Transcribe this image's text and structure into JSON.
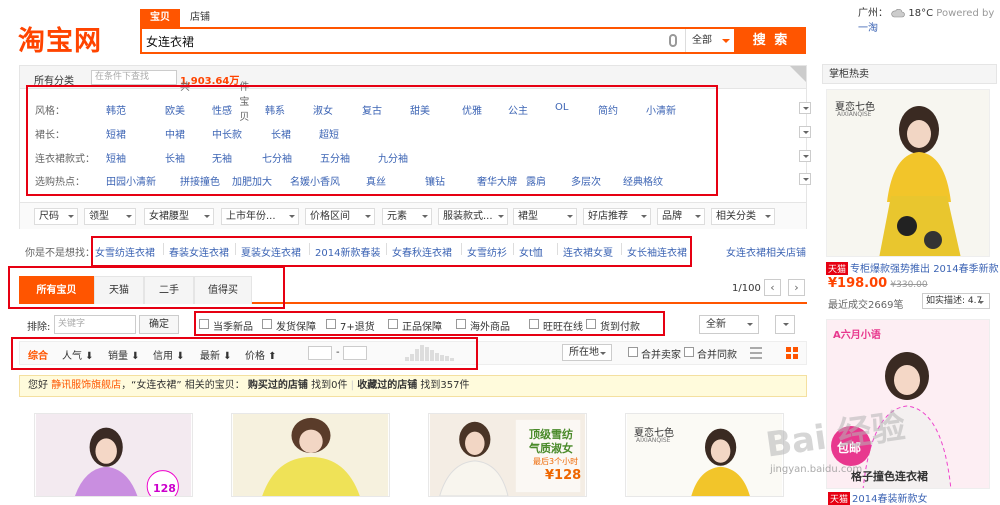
{
  "header": {
    "logo": "淘宝网",
    "search_tabs": [
      "宝贝",
      "店铺"
    ],
    "search_value": "女连衣裙",
    "search_scope": "全部",
    "search_button": "搜 索",
    "city": "广州：",
    "temperature": "18°C",
    "powered_by": "Powered by",
    "powered_brand": "一淘"
  },
  "filter": {
    "all_category": "所有分类",
    "search_placeholder": "在条件下查找",
    "count_prefix": "共",
    "count": "1,903.64万",
    "count_suffix": "件宝贝",
    "rows": [
      {
        "label": "风格：",
        "items": [
          "韩范",
          "欧美",
          "性感",
          "韩系",
          "淑女",
          "复古",
          "甜美",
          "优雅",
          "公主",
          "OL",
          "简约",
          "小清新"
        ]
      },
      {
        "label": "裙长：",
        "items": [
          "短裙",
          "中裙",
          "中长款",
          "长裙",
          "超短"
        ]
      },
      {
        "label": "连衣裙款式：",
        "items": [
          "短袖",
          "长袖",
          "无袖",
          "七分袖",
          "五分袖",
          "九分袖"
        ]
      },
      {
        "label": "选购热点：",
        "items": [
          "田园小清新",
          "拼接撞色",
          "加肥加大",
          "名媛小香风",
          "真丝",
          "镶钻",
          "奢华大牌",
          "露肩",
          "多层次",
          "经典格纹"
        ]
      }
    ],
    "dropdowns": [
      "尺码",
      "领型",
      "女裙腰型",
      "上市年份...",
      "价格区间",
      "元素",
      "服装款式...",
      "裙型",
      "好店推荐",
      "品牌",
      "相关分类"
    ]
  },
  "want": {
    "label": "你是不是想找：",
    "items": [
      "女雪纺连衣裙",
      "春装女连衣裙",
      "夏装女连衣裙",
      "2014新款春装",
      "女春秋连衣裙",
      "女雪纺衫",
      "女t恤",
      "连衣裙女夏",
      "女长袖连衣裙"
    ],
    "related": "女连衣裙相关店铺"
  },
  "tabs": [
    "所有宝贝",
    "天猫",
    "二手",
    "值得买"
  ],
  "pager": {
    "text": "1/100",
    "prev": "‹",
    "next": "›"
  },
  "options": {
    "exclude_label": "排除:",
    "exclude_placeholder": "关键字",
    "ok": "确定",
    "checks": [
      "当季新品",
      "发货保障",
      "7+退货",
      "正品保障",
      "海外商品",
      "旺旺在线",
      "货到付款"
    ],
    "location_select": "全新"
  },
  "sort": {
    "items": [
      "综合",
      "人气",
      "销量",
      "信用",
      "最新",
      "价格"
    ],
    "location": "所在地",
    "merge1": "合并卖家",
    "merge2": "合并同款",
    "dash": "-"
  },
  "notice": {
    "p1": "您好",
    "shop": "静讯服饰旗舰店",
    "p2": "，“女连衣裙” 相关的宝贝：",
    "b1": "购买过的店铺",
    "p3": "找到0件",
    "sep": "|",
    "b2": "收藏过的店铺",
    "p4": "找到357件"
  },
  "products": [
    {
      "tag": "128"
    },
    {
      "tag": ""
    },
    {
      "tag1": "顶级雪纺",
      "tag2": "气质淑女",
      "tag3": "最后3个小时",
      "price": "¥128"
    },
    {
      "brand": "夏恋七色",
      "brand_en": "AIXIANQISE"
    }
  ],
  "sidebar": {
    "title": "掌柜热卖",
    "p1_brand": "夏恋七色",
    "p1_brand_en": "AIXIANQISE",
    "p1_tmall": "天猫",
    "p1_desc": "专柜爆款强势推出 2014春季新款",
    "p1_price": "¥198.00",
    "p1_old": "¥330.00",
    "p1_sales": "最近成交2669笔",
    "p1_rating": "如实描述: 4.7",
    "p2_brand": "A六月小语",
    "p2_tag": "包邮",
    "p2_desc": "格子撞色连衣裙",
    "p3_tmall": "天猫",
    "p3_desc": "2014春装新款女",
    "watermark": "Bai 经验",
    "watermark_url": "jingyan.baidu.com"
  },
  "colors": {
    "accent": "#ff5500",
    "link": "#3c64b4",
    "annotation": "#e60012"
  }
}
